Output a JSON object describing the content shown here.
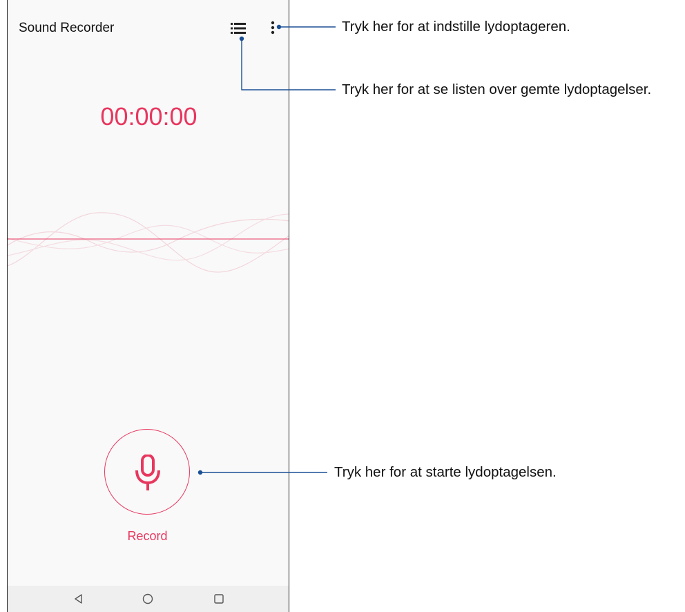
{
  "app": {
    "title": "Sound Recorder",
    "timer": "00:00:00",
    "record_label": "Record"
  },
  "toolbar": {
    "icons": [
      "list-icon",
      "more-vert-icon"
    ]
  },
  "navbar": {
    "icons": [
      "back-triangle-icon",
      "home-circle-icon",
      "recents-square-icon"
    ]
  },
  "callouts": {
    "settings": "Tryk her for at indstille lydoptageren.",
    "list": "Tryk her for at se listen over gemte lydoptagelser.",
    "record": "Tryk her for at starte lydoptagelsen."
  },
  "colors": {
    "accent": "#e8375f",
    "callout_line": "#1a4f95",
    "background": "#f9f9f9",
    "navbar": "#efefef"
  }
}
